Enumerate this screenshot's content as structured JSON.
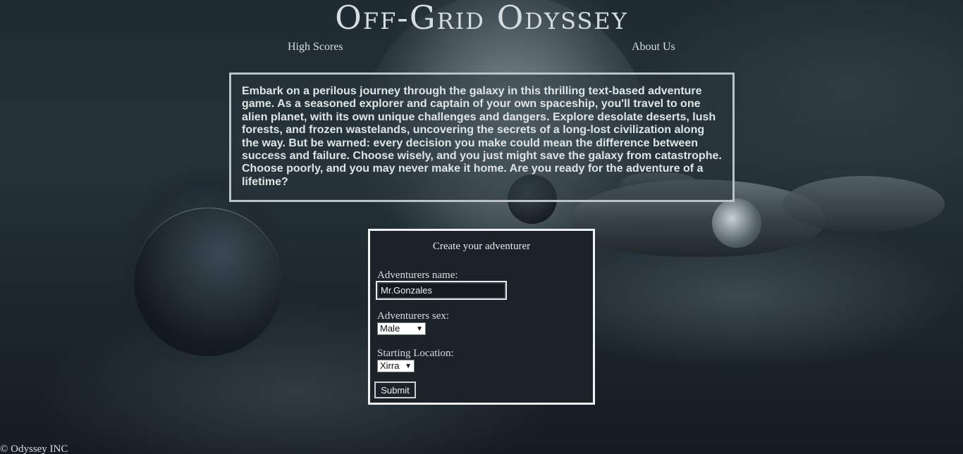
{
  "site": {
    "title": "Off-Grid Odyssey"
  },
  "nav": {
    "high_scores": "High Scores",
    "about_us": "About Us"
  },
  "intro": {
    "text": "Embark on a perilous journey through the galaxy in this thrilling text-based adventure game. As a seasoned explorer and captain of your own spaceship, you'll travel to one alien planet, with its own unique challenges and dangers. Explore desolate deserts, lush forests, and frozen wastelands, uncovering the secrets of a long-lost civilization along the way. But be warned: every decision you make could mean the difference between success and failure. Choose wisely, and you just might save the galaxy from catastrophe. Choose poorly, and you may never make it home. Are you ready for the adventure of a lifetime?"
  },
  "form": {
    "heading": "Create your adventurer",
    "name_label": "Adventurers name:",
    "name_value": "Mr.Gonzales",
    "sex_label": "Adventurers sex:",
    "sex_selected": "Male",
    "location_label": "Starting Location:",
    "location_selected": "Xirra",
    "submit_label": "Submit"
  },
  "footer": {
    "text": "© Odyssey INC"
  }
}
